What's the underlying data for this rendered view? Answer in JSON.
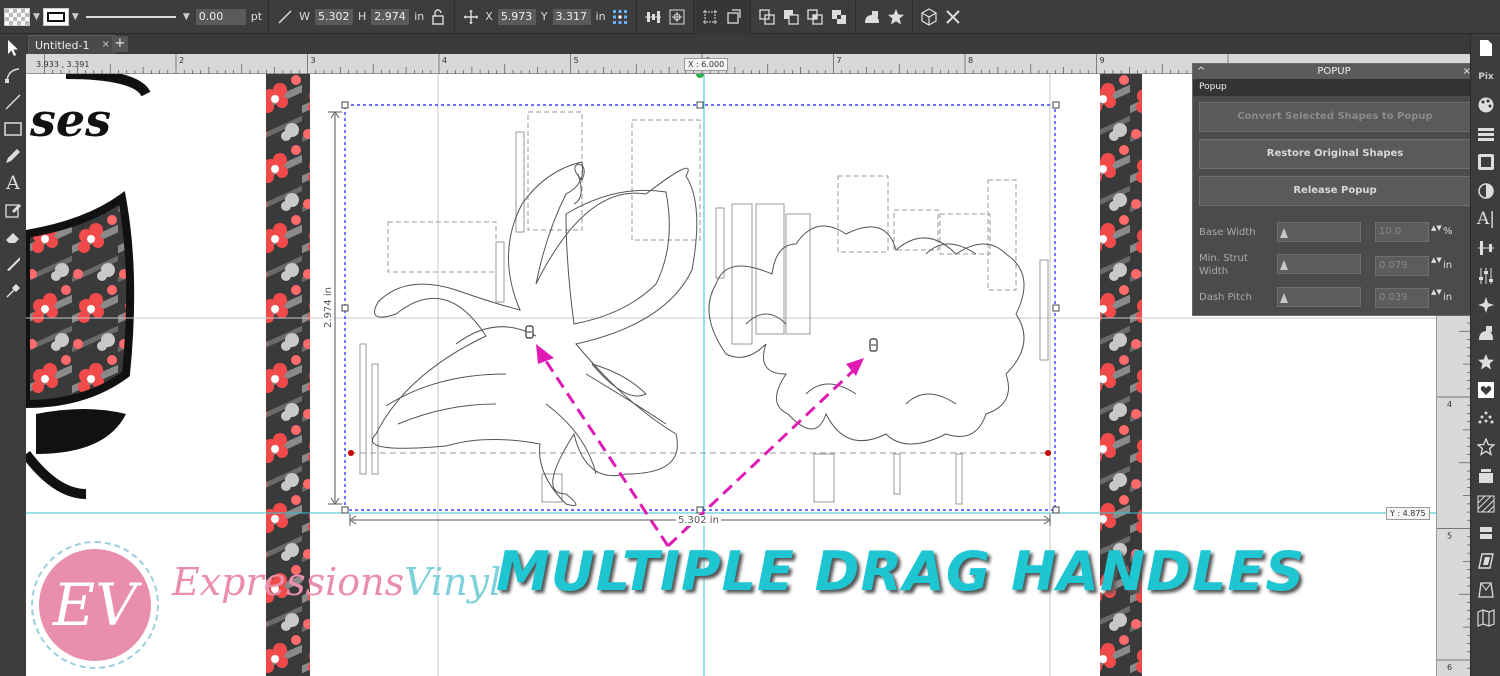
{
  "toolbar": {
    "stroke_width": "0.00",
    "stroke_unit": "pt",
    "w_label": "W",
    "w_value": "5.302",
    "h_label": "H",
    "h_value": "2.974",
    "size_unit": "in",
    "x_label": "X",
    "x_value": "5.973",
    "y_label": "Y",
    "y_value": "3.317",
    "pos_unit": "in",
    "icons": [
      "fill-swatch",
      "stroke-swatch",
      "line-style",
      "size-icon",
      "lock-icon",
      "move-icon",
      "align-grid-icon",
      "distribute-icon",
      "anchor-icon",
      "crop-icon",
      "transform-icon",
      "weld-icon",
      "subtract-icon",
      "intersect-icon",
      "exclude-icon",
      "shape-icon",
      "star-icon",
      "3d-box-icon",
      "close-icon"
    ]
  },
  "tabs": {
    "doc_title": "Untitled-1",
    "close": "×",
    "add": "+"
  },
  "rulers": {
    "top_ticks": [
      "2",
      "3",
      "4",
      "5",
      "6",
      "7",
      "8",
      "9"
    ],
    "right_ticks": [
      "4",
      "5",
      "6"
    ],
    "cursor_coords": "3.933 , 3.391",
    "x_readout": "X : 6.000",
    "y_readout": "Y : 4.875"
  },
  "canvas": {
    "width_dim": "5.302 in",
    "height_dim": "2.974 in",
    "cursive_text": "ses"
  },
  "popup": {
    "title": "POPUP",
    "subtitle": "Popup",
    "collapse": "^",
    "close": "×",
    "btn_convert": "Convert Selected Shapes to Popup",
    "btn_restore": "Restore Original Shapes",
    "btn_release": "Release Popup",
    "base_width_label": "Base Width",
    "base_width_value": "10.0",
    "base_width_unit": "%",
    "min_strut_label": "Min. Strut Width",
    "min_strut_value": "0.079",
    "min_strut_unit": "in",
    "dash_pitch_label": "Dash Pitch",
    "dash_pitch_value": "0.039",
    "dash_pitch_unit": "in",
    "spin": "▲▼"
  },
  "overlay": {
    "banner": "MULTIPLE DRAG HANDLES",
    "logo_initials": "EV",
    "logo_word1": "Expressions",
    "logo_word2": "Vinyl"
  },
  "colors": {
    "accent_cyan": "#1ec6d2",
    "arrow_magenta": "#e01ab4",
    "logo_pink": "#e98fab",
    "selection_blue": "#1a1aff"
  }
}
